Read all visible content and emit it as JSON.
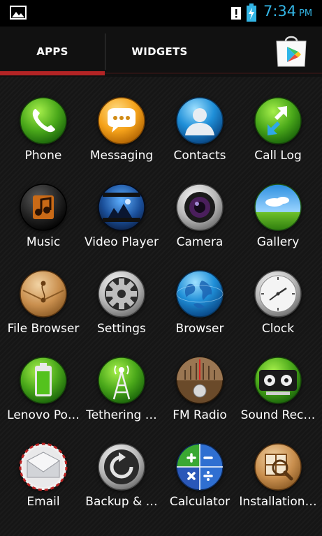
{
  "status_bar": {
    "time": "7:34",
    "ampm": "PM"
  },
  "tabs": [
    {
      "label": "APPS",
      "active": true
    },
    {
      "label": "WIDGETS",
      "active": false
    }
  ],
  "store_icon": "play-store-icon",
  "accent_color": "#b32425",
  "clock_color": "#33b5e5",
  "apps": [
    {
      "label": "Phone",
      "icon": "phone-icon"
    },
    {
      "label": "Messaging",
      "icon": "messaging-icon"
    },
    {
      "label": "Contacts",
      "icon": "contacts-icon"
    },
    {
      "label": "Call Log",
      "icon": "call-log-icon"
    },
    {
      "label": "Music",
      "icon": "music-icon"
    },
    {
      "label": "Video Player",
      "icon": "video-player-icon"
    },
    {
      "label": "Camera",
      "icon": "camera-icon"
    },
    {
      "label": "Gallery",
      "icon": "gallery-icon"
    },
    {
      "label": "File Browser",
      "icon": "file-browser-icon"
    },
    {
      "label": "Settings",
      "icon": "settings-icon"
    },
    {
      "label": "Browser",
      "icon": "browser-icon"
    },
    {
      "label": "Clock",
      "icon": "clock-icon"
    },
    {
      "label": "Lenovo Po…",
      "icon": "battery-icon"
    },
    {
      "label": "Tethering …",
      "icon": "tethering-icon"
    },
    {
      "label": "FM Radio",
      "icon": "fm-radio-icon"
    },
    {
      "label": "Sound Rec…",
      "icon": "sound-recorder-icon"
    },
    {
      "label": "Email",
      "icon": "email-icon"
    },
    {
      "label": "Backup & …",
      "icon": "backup-icon"
    },
    {
      "label": "Calculator",
      "icon": "calculator-icon"
    },
    {
      "label": "Installation…",
      "icon": "installation-icon"
    }
  ]
}
